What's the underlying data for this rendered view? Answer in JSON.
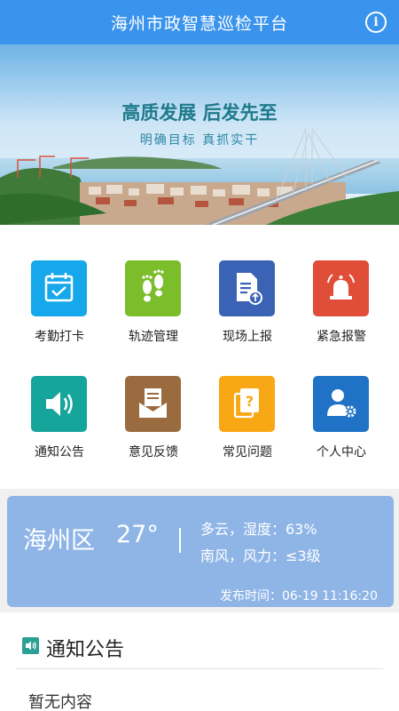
{
  "header": {
    "title": "海州市政智慧巡检平台",
    "info_icon": "info-icon"
  },
  "banner": {
    "slogan": "高质发展 后发先至",
    "subslogan": "明确目标 真抓实干"
  },
  "menu": [
    {
      "label": "考勤打卡",
      "icon": "calendar-check-icon",
      "color": "#16a8ea"
    },
    {
      "label": "轨迹管理",
      "icon": "footprints-icon",
      "color": "#7cbd2c"
    },
    {
      "label": "现场上报",
      "icon": "document-upload-icon",
      "color": "#3a63b5"
    },
    {
      "label": "紧急报警",
      "icon": "alarm-bell-icon",
      "color": "#e04d38"
    },
    {
      "label": "通知公告",
      "icon": "speaker-icon",
      "color": "#16a59a"
    },
    {
      "label": "意见反馈",
      "icon": "mail-tray-icon",
      "color": "#9a6b3f"
    },
    {
      "label": "常见问题",
      "icon": "question-cards-icon",
      "color": "#f8a715"
    },
    {
      "label": "个人中心",
      "icon": "user-settings-icon",
      "color": "#1f72c5"
    }
  ],
  "weather": {
    "city": "海州区",
    "temp": "27°",
    "line1": "多云，湿度：63%",
    "line2": "南风，风力：≤3级",
    "publish": "发布时间：06-19 11:16:20",
    "bg_color": "#8fb5e7"
  },
  "notice": {
    "title": "通知公告",
    "empty": "暂无内容",
    "icon": "speaker-icon"
  },
  "colors": {
    "header": "#3a93ec",
    "accent": "#2b9f93"
  }
}
